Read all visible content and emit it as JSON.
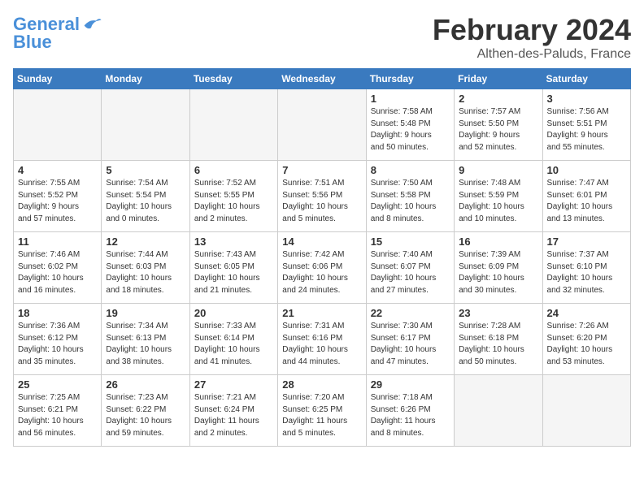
{
  "logo": {
    "line1": "General",
    "line2": "Blue"
  },
  "title": "February 2024",
  "location": "Althen-des-Paluds, France",
  "days_of_week": [
    "Sunday",
    "Monday",
    "Tuesday",
    "Wednesday",
    "Thursday",
    "Friday",
    "Saturday"
  ],
  "weeks": [
    [
      {
        "day": "",
        "info": ""
      },
      {
        "day": "",
        "info": ""
      },
      {
        "day": "",
        "info": ""
      },
      {
        "day": "",
        "info": ""
      },
      {
        "day": "1",
        "info": "Sunrise: 7:58 AM\nSunset: 5:48 PM\nDaylight: 9 hours\nand 50 minutes."
      },
      {
        "day": "2",
        "info": "Sunrise: 7:57 AM\nSunset: 5:50 PM\nDaylight: 9 hours\nand 52 minutes."
      },
      {
        "day": "3",
        "info": "Sunrise: 7:56 AM\nSunset: 5:51 PM\nDaylight: 9 hours\nand 55 minutes."
      }
    ],
    [
      {
        "day": "4",
        "info": "Sunrise: 7:55 AM\nSunset: 5:52 PM\nDaylight: 9 hours\nand 57 minutes."
      },
      {
        "day": "5",
        "info": "Sunrise: 7:54 AM\nSunset: 5:54 PM\nDaylight: 10 hours\nand 0 minutes."
      },
      {
        "day": "6",
        "info": "Sunrise: 7:52 AM\nSunset: 5:55 PM\nDaylight: 10 hours\nand 2 minutes."
      },
      {
        "day": "7",
        "info": "Sunrise: 7:51 AM\nSunset: 5:56 PM\nDaylight: 10 hours\nand 5 minutes."
      },
      {
        "day": "8",
        "info": "Sunrise: 7:50 AM\nSunset: 5:58 PM\nDaylight: 10 hours\nand 8 minutes."
      },
      {
        "day": "9",
        "info": "Sunrise: 7:48 AM\nSunset: 5:59 PM\nDaylight: 10 hours\nand 10 minutes."
      },
      {
        "day": "10",
        "info": "Sunrise: 7:47 AM\nSunset: 6:01 PM\nDaylight: 10 hours\nand 13 minutes."
      }
    ],
    [
      {
        "day": "11",
        "info": "Sunrise: 7:46 AM\nSunset: 6:02 PM\nDaylight: 10 hours\nand 16 minutes."
      },
      {
        "day": "12",
        "info": "Sunrise: 7:44 AM\nSunset: 6:03 PM\nDaylight: 10 hours\nand 18 minutes."
      },
      {
        "day": "13",
        "info": "Sunrise: 7:43 AM\nSunset: 6:05 PM\nDaylight: 10 hours\nand 21 minutes."
      },
      {
        "day": "14",
        "info": "Sunrise: 7:42 AM\nSunset: 6:06 PM\nDaylight: 10 hours\nand 24 minutes."
      },
      {
        "day": "15",
        "info": "Sunrise: 7:40 AM\nSunset: 6:07 PM\nDaylight: 10 hours\nand 27 minutes."
      },
      {
        "day": "16",
        "info": "Sunrise: 7:39 AM\nSunset: 6:09 PM\nDaylight: 10 hours\nand 30 minutes."
      },
      {
        "day": "17",
        "info": "Sunrise: 7:37 AM\nSunset: 6:10 PM\nDaylight: 10 hours\nand 32 minutes."
      }
    ],
    [
      {
        "day": "18",
        "info": "Sunrise: 7:36 AM\nSunset: 6:12 PM\nDaylight: 10 hours\nand 35 minutes."
      },
      {
        "day": "19",
        "info": "Sunrise: 7:34 AM\nSunset: 6:13 PM\nDaylight: 10 hours\nand 38 minutes."
      },
      {
        "day": "20",
        "info": "Sunrise: 7:33 AM\nSunset: 6:14 PM\nDaylight: 10 hours\nand 41 minutes."
      },
      {
        "day": "21",
        "info": "Sunrise: 7:31 AM\nSunset: 6:16 PM\nDaylight: 10 hours\nand 44 minutes."
      },
      {
        "day": "22",
        "info": "Sunrise: 7:30 AM\nSunset: 6:17 PM\nDaylight: 10 hours\nand 47 minutes."
      },
      {
        "day": "23",
        "info": "Sunrise: 7:28 AM\nSunset: 6:18 PM\nDaylight: 10 hours\nand 50 minutes."
      },
      {
        "day": "24",
        "info": "Sunrise: 7:26 AM\nSunset: 6:20 PM\nDaylight: 10 hours\nand 53 minutes."
      }
    ],
    [
      {
        "day": "25",
        "info": "Sunrise: 7:25 AM\nSunset: 6:21 PM\nDaylight: 10 hours\nand 56 minutes."
      },
      {
        "day": "26",
        "info": "Sunrise: 7:23 AM\nSunset: 6:22 PM\nDaylight: 10 hours\nand 59 minutes."
      },
      {
        "day": "27",
        "info": "Sunrise: 7:21 AM\nSunset: 6:24 PM\nDaylight: 11 hours\nand 2 minutes."
      },
      {
        "day": "28",
        "info": "Sunrise: 7:20 AM\nSunset: 6:25 PM\nDaylight: 11 hours\nand 5 minutes."
      },
      {
        "day": "29",
        "info": "Sunrise: 7:18 AM\nSunset: 6:26 PM\nDaylight: 11 hours\nand 8 minutes."
      },
      {
        "day": "",
        "info": ""
      },
      {
        "day": "",
        "info": ""
      }
    ]
  ]
}
